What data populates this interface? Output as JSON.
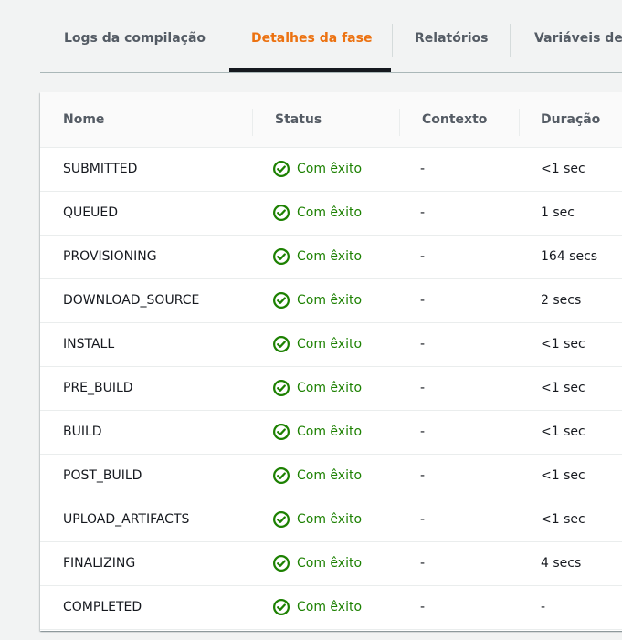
{
  "tabs": [
    {
      "label": "Logs da compilação",
      "active": false
    },
    {
      "label": "Detalhes da fase",
      "active": true
    },
    {
      "label": "Relatórios",
      "active": false
    },
    {
      "label": "Variáveis de",
      "active": false
    }
  ],
  "table": {
    "columns": [
      "Nome",
      "Status",
      "Contexto",
      "Duração"
    ],
    "rows": [
      {
        "name": "SUBMITTED",
        "status": "Com êxito",
        "context": "-",
        "duration": "<1 sec"
      },
      {
        "name": "QUEUED",
        "status": "Com êxito",
        "context": "-",
        "duration": "1 sec"
      },
      {
        "name": "PROVISIONING",
        "status": "Com êxito",
        "context": "-",
        "duration": "164 secs"
      },
      {
        "name": "DOWNLOAD_SOURCE",
        "status": "Com êxito",
        "context": "-",
        "duration": "2 secs"
      },
      {
        "name": "INSTALL",
        "status": "Com êxito",
        "context": "-",
        "duration": "<1 sec"
      },
      {
        "name": "PRE_BUILD",
        "status": "Com êxito",
        "context": "-",
        "duration": "<1 sec"
      },
      {
        "name": "BUILD",
        "status": "Com êxito",
        "context": "-",
        "duration": "<1 sec"
      },
      {
        "name": "POST_BUILD",
        "status": "Com êxito",
        "context": "-",
        "duration": "<1 sec"
      },
      {
        "name": "UPLOAD_ARTIFACTS",
        "status": "Com êxito",
        "context": "-",
        "duration": "<1 sec"
      },
      {
        "name": "FINALIZING",
        "status": "Com êxito",
        "context": "-",
        "duration": "4 secs"
      },
      {
        "name": "COMPLETED",
        "status": "Com êxito",
        "context": "-",
        "duration": "-"
      }
    ]
  },
  "icons": {
    "status": "check-circle-icon"
  },
  "colors": {
    "active_tab": "#ec7211",
    "success": "#1d8102",
    "tab_underline": "#16191f"
  }
}
